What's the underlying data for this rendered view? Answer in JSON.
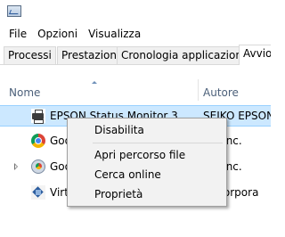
{
  "title_icon": "task-manager-icon",
  "menubar": {
    "items": [
      "File",
      "Opzioni",
      "Visualizza"
    ]
  },
  "tabs": [
    {
      "label": "Processi"
    },
    {
      "label": "Prestazioni"
    },
    {
      "label": "Cronologia applicazioni"
    },
    {
      "label": "Avvio"
    }
  ],
  "active_tab": "Avvio",
  "columns": {
    "name": "Nome",
    "author": "Autore"
  },
  "rows": [
    {
      "name": "EPSON Status Monitor 3",
      "author": "SEIKO EPSON C",
      "icon": "printer-icon",
      "selected": true
    },
    {
      "name": "Goo",
      "author": "gle Inc.",
      "icon": "chrome-icon"
    },
    {
      "name": "Goo",
      "author": "gle Inc.",
      "icon": "google-update-icon"
    },
    {
      "name": "Virt",
      "author": "le Corpora",
      "icon": "virtualbox-icon"
    }
  ],
  "context_menu": {
    "items": [
      {
        "label": "Disabilita"
      },
      {
        "label": "Apri percorso file"
      },
      {
        "label": "Cerca online"
      },
      {
        "label": "Proprietà"
      }
    ]
  },
  "colors": {
    "selection": "#cce8ff",
    "selection_border": "#99d1ff",
    "header_text": "#4c607a",
    "menu_bg": "#f2f2f2"
  }
}
